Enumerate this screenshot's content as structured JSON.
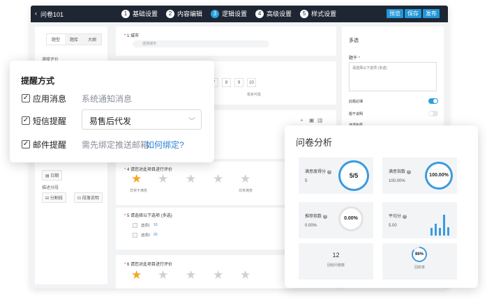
{
  "topbar": {
    "back_label": "‹",
    "title": "问卷101",
    "steps": [
      {
        "num": "1",
        "label": "基础设置"
      },
      {
        "num": "2",
        "label": "内容编辑"
      },
      {
        "num": "3",
        "label": "逻辑设置"
      },
      {
        "num": "4",
        "label": "高级设置"
      },
      {
        "num": "5",
        "label": "样式设置"
      }
    ],
    "preview_label": "预览",
    "save_label": "保存",
    "publish_label": "发布"
  },
  "left_panel": {
    "tabs": [
      "题型",
      "题库",
      "大纲"
    ],
    "section_label": "满度评价",
    "date_label": "日期",
    "describe_label": "描述分段",
    "divider_label": "分割线",
    "paragraph_label": "段落说明"
  },
  "questions": {
    "q1": {
      "num": "1",
      "title": "城市",
      "placeholder": "选择城市"
    },
    "scale": {
      "values": [
        "7",
        "8",
        "9",
        "10"
      ],
      "high_label": "极有可能"
    },
    "q4": {
      "num": "4",
      "title": "请您对此项目进行评价",
      "low_label": "非常不满意",
      "high_label": "非常满意",
      "rating": 1,
      "max": 5
    },
    "q5": {
      "num": "5",
      "title": "请选择以下选项 (多选)",
      "options": [
        {
          "label": "选项1",
          "tag": "10"
        },
        {
          "label": "选项2",
          "tag": "20"
        }
      ]
    },
    "q6": {
      "num": "6",
      "title": "请您对此项目进行评价",
      "rating": 1,
      "max": 5
    }
  },
  "right_panel": {
    "title": "多选",
    "stem_label": "题干",
    "stem_value": "请选择以下选项 (多选)",
    "required_label": "此题必填",
    "required_on": true,
    "desc_label": "题干说明",
    "desc_on": false,
    "options_label": "选项布局"
  },
  "reminder": {
    "title": "提醒方式",
    "items": [
      {
        "label": "应用消息",
        "checked": true,
        "note": "系统通知消息"
      },
      {
        "label": "短信提醒",
        "checked": true,
        "select_value": "易售后代发"
      },
      {
        "label": "邮件提醒",
        "checked": true,
        "note": "需先绑定推送邮箱",
        "link": "如何绑定?"
      }
    ]
  },
  "analysis": {
    "title": "问卷分析",
    "tiles": [
      {
        "label": "满意度得分",
        "value": "5",
        "ring": "5/5",
        "fraction": 1.0
      },
      {
        "label": "满意指数",
        "value": "100.00%",
        "ring": "100.00%",
        "fraction": 1.0
      },
      {
        "label": "推荐指数",
        "value": "0.00%",
        "ring": "0.00%",
        "fraction": 0.0
      },
      {
        "label": "平均分",
        "value": "5.00",
        "bars": [
          0.35,
          0.55,
          0.35,
          1.0,
          0.4
        ]
      },
      {
        "count": "12",
        "count_label": "回收问卷数"
      },
      {
        "ring": "86%",
        "fraction": 0.86,
        "ring_label": "回收率"
      }
    ],
    "accent": "#3a9be0"
  }
}
